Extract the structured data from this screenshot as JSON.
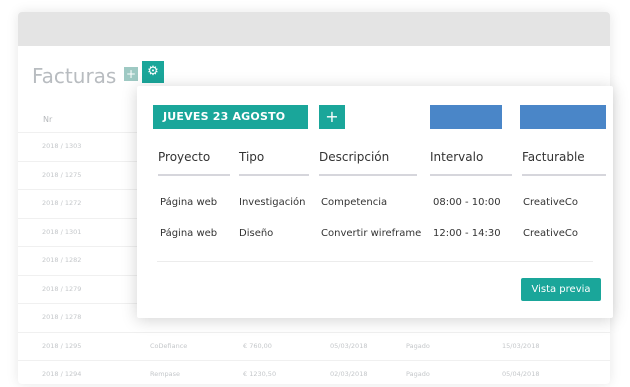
{
  "background": {
    "title": "Facturas",
    "plus_label": "+",
    "settings_label": "⚙",
    "column_nr": "Nr",
    "rows": [
      [
        "2018 / 1303",
        "",
        "",
        "",
        "",
        ""
      ],
      [
        "2018 / 1275",
        "",
        "",
        "",
        "",
        ""
      ],
      [
        "2018 / 1272",
        "",
        "",
        "",
        "",
        ""
      ],
      [
        "2018 / 1301",
        "",
        "",
        "",
        "",
        ""
      ],
      [
        "2018 / 1282",
        "",
        "",
        "",
        "",
        ""
      ],
      [
        "2018 / 1279",
        "",
        "",
        "",
        "",
        ""
      ],
      [
        "2018 / 1278",
        "",
        "",
        "",
        "",
        ""
      ],
      [
        "2018 / 1295",
        "CoDefiance",
        "€ 760,00",
        "05/03/2018",
        "Pagado",
        "15/03/2018"
      ],
      [
        "2018 / 1294",
        "Rempase",
        "€ 1230,50",
        "02/03/2018",
        "Pagado",
        "05/04/2018"
      ]
    ]
  },
  "modal": {
    "date_label": "JUEVES 23 AGOSTO",
    "add_label": "+",
    "columns": [
      "Proyecto",
      "Tipo",
      "Descripción",
      "Intervalo",
      "Facturable"
    ],
    "entries": [
      {
        "proyecto": "Página web",
        "tipo": "Investigación",
        "descripcion": "Competencia",
        "intervalo": "08:00 - 10:00",
        "facturable": "CreativeCo"
      },
      {
        "proyecto": "Página web",
        "tipo": "Diseño",
        "descripcion": "Convertir wireframe",
        "intervalo": "12:00 - 14:30",
        "facturable": "CreativeCo"
      }
    ],
    "preview_label": "Vista previa"
  },
  "colors": {
    "accent": "#1aa69a",
    "blue": "#4a86c8"
  }
}
